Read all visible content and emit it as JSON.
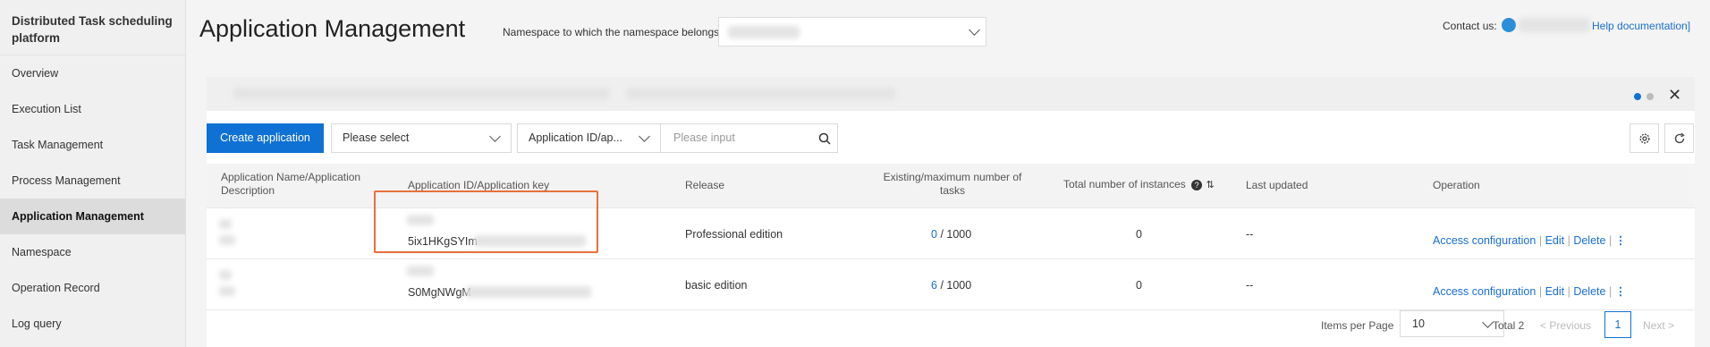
{
  "sidebar": {
    "title": "Distributed Task scheduling platform",
    "items": [
      {
        "label": "Overview"
      },
      {
        "label": "Execution List"
      },
      {
        "label": "Task Management"
      },
      {
        "label": "Process Management"
      },
      {
        "label": "Application Management",
        "active": true
      },
      {
        "label": "Namespace"
      },
      {
        "label": "Operation Record"
      },
      {
        "label": "Log query"
      }
    ]
  },
  "header": {
    "title": "Application Management",
    "namespace_label": "Namespace to which the namespace belongs:",
    "contact_label": "Contact us:",
    "help_link": "Help documentation]"
  },
  "toolbar": {
    "create_button": "Create application",
    "filter_select": "Please select",
    "search_field_select": "Application ID/ap...",
    "search_placeholder": "Please input"
  },
  "table": {
    "columns": [
      "Application Name/Application Description",
      "Application ID/Application key",
      "Release",
      "Existing/maximum number of tasks",
      "Total number of instances",
      "Last updated",
      "Operation"
    ],
    "rows": [
      {
        "app_key": "5ix1HKgSYIm",
        "release": "Professional edition",
        "existing": "0",
        "max": "/ 1000",
        "instances": "0",
        "updated": "--"
      },
      {
        "app_key": "S0MgNWgM",
        "release": "basic edition",
        "existing": "6",
        "max": "/ 1000",
        "instances": "0",
        "updated": "--"
      }
    ],
    "actions": {
      "access": "Access configuration",
      "edit": "Edit",
      "delete": "Delete",
      "more": "⋮"
    }
  },
  "pagination": {
    "items_per_page_label": "Items per Page",
    "page_size": "10",
    "total": "Total 2",
    "previous": "Previous",
    "current_page": "1",
    "next": "Next"
  },
  "colors": {
    "accent": "#1071d4",
    "highlight": "#e8703a"
  }
}
